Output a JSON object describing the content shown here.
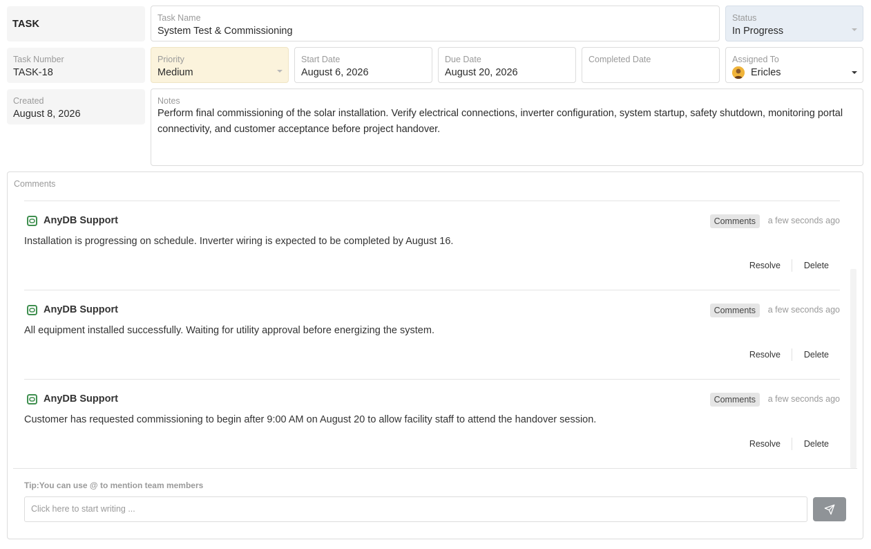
{
  "task": {
    "heading": "TASK",
    "task_name": {
      "label": "Task Name",
      "value": "System Test & Commissioning"
    },
    "status": {
      "label": "Status",
      "value": "In Progress"
    },
    "task_number": {
      "label": "Task Number",
      "value": "TASK-18"
    },
    "priority": {
      "label": "Priority",
      "value": "Medium"
    },
    "start_date": {
      "label": "Start Date",
      "value": "August 6, 2026"
    },
    "due_date": {
      "label": "Due Date",
      "value": "August 20, 2026"
    },
    "completed_date": {
      "label": "Completed Date",
      "value": ""
    },
    "assigned_to": {
      "label": "Assigned To",
      "value": "Ericles"
    },
    "created": {
      "label": "Created",
      "value": "August 8, 2026"
    },
    "notes": {
      "label": "Notes",
      "value": "Perform final commissioning of the solar installation. Verify electrical connections, inverter configuration, system startup, safety shutdown, monitoring portal connectivity, and customer acceptance before project handover."
    }
  },
  "comments": {
    "title": "Comments",
    "items": [
      {
        "author": "AnyDB Support",
        "tag": "Comments",
        "time": "a few seconds ago",
        "text": "Installation is progressing on schedule. Inverter wiring is expected to be completed by August 16.",
        "resolve_label": "Resolve",
        "delete_label": "Delete"
      },
      {
        "author": "AnyDB Support",
        "tag": "Comments",
        "time": "a few seconds ago",
        "text": "All equipment installed successfully. Waiting for utility approval before energizing the system.",
        "resolve_label": "Resolve",
        "delete_label": "Delete"
      },
      {
        "author": "AnyDB Support",
        "tag": "Comments",
        "time": "a few seconds ago",
        "text": "Customer has requested commissioning to begin after 9:00 AM on August 20 to allow facility staff to attend the handover session.",
        "resolve_label": "Resolve",
        "delete_label": "Delete"
      }
    ],
    "tip_prefix": "Tip:",
    "tip_text": "You can use @ to mention team members",
    "composer_placeholder": "Click here to start writing ..."
  },
  "colors": {
    "status_bg": "#e8eef5",
    "priority_bg": "#fbf3dc",
    "icon_green": "#3f8f4f",
    "send_button": "#8f9397"
  },
  "icons": {
    "comment_author": "anydb-logo-icon",
    "send": "send-icon",
    "dropdown": "caret-down-icon"
  }
}
